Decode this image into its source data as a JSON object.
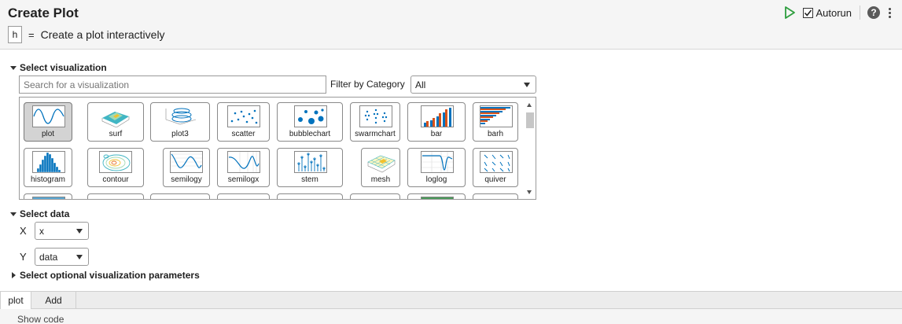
{
  "header": {
    "title": "Create Plot",
    "variable_name": "h",
    "equals": "=",
    "description": "Create a plot interactively",
    "autorun_label": "Autorun",
    "autorun_checked": true,
    "help_glyph": "?",
    "colors": {
      "run": "#2e9e3e",
      "accent": "#0072bd"
    }
  },
  "visualization": {
    "section_title": "Select visualization",
    "search_placeholder": "Search for a visualization",
    "filter_label": "Filter by Category",
    "filter_value": "All",
    "selected": "plot",
    "tiles": [
      {
        "label": "plot",
        "icon": "plot-icon"
      },
      {
        "label": "surf",
        "icon": "surf-icon"
      },
      {
        "label": "plot3",
        "icon": "plot3-icon"
      },
      {
        "label": "scatter",
        "icon": "scatter-icon"
      },
      {
        "label": "bubblechart",
        "icon": "bubblechart-icon"
      },
      {
        "label": "swarmchart",
        "icon": "swarmchart-icon"
      },
      {
        "label": "bar",
        "icon": "bar-icon"
      },
      {
        "label": "barh",
        "icon": "barh-icon"
      },
      {
        "label": "histogram",
        "icon": "histogram-icon"
      },
      {
        "label": "contour",
        "icon": "contour-icon"
      },
      {
        "label": "semilogy",
        "icon": "semilogy-icon"
      },
      {
        "label": "semilogx",
        "icon": "semilogx-icon"
      },
      {
        "label": "stem",
        "icon": "stem-icon"
      },
      {
        "label": "mesh",
        "icon": "mesh-icon"
      },
      {
        "label": "loglog",
        "icon": "loglog-icon"
      },
      {
        "label": "quiver",
        "icon": "quiver-icon"
      }
    ]
  },
  "data": {
    "section_title": "Select data",
    "x_label": "X",
    "x_value": "x",
    "y_label": "Y",
    "y_value": "data"
  },
  "optional": {
    "section_title": "Select optional visualization parameters"
  },
  "tabs": [
    {
      "label": "plot",
      "active": true
    },
    {
      "label": "Add",
      "active": false
    }
  ],
  "footer": {
    "show_code": "Show code"
  }
}
